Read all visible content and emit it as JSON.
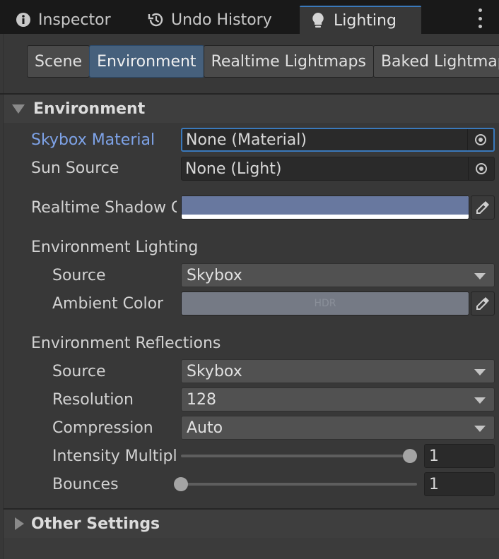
{
  "window_tabs": [
    {
      "label": "Inspector",
      "icon": "info-icon"
    },
    {
      "label": "Undo History",
      "icon": "history-icon"
    },
    {
      "label": "Lighting",
      "icon": "lightbulb-icon",
      "active": true
    }
  ],
  "sub_tabs": [
    "Scene",
    "Environment",
    "Realtime Lightmaps",
    "Baked Lightmaps"
  ],
  "environment": {
    "header": "Environment",
    "skybox_material": {
      "label": "Skybox Material",
      "value": "None (Material)"
    },
    "sun_source": {
      "label": "Sun Source",
      "value": "None (Light)"
    },
    "realtime_shadow_color": {
      "label": "Realtime Shadow Color",
      "color": "#68789f"
    },
    "env_lighting": {
      "header": "Environment Lighting",
      "source": {
        "label": "Source",
        "value": "Skybox"
      },
      "ambient_color": {
        "label": "Ambient Color",
        "color": "#757a85",
        "badge": "HDR"
      }
    },
    "env_reflections": {
      "header": "Environment Reflections",
      "source": {
        "label": "Source",
        "value": "Skybox"
      },
      "resolution": {
        "label": "Resolution",
        "value": "128"
      },
      "compression": {
        "label": "Compression",
        "value": "Auto"
      },
      "intensity": {
        "label": "Intensity Multiplier",
        "value": "1",
        "level": 1.0
      },
      "bounces": {
        "label": "Bounces",
        "value": "1",
        "level": 0.0
      }
    }
  },
  "other_settings": {
    "header": "Other Settings"
  },
  "colors": {
    "accent": "#3a79bb",
    "label_highlight": "#7ea3e8"
  }
}
